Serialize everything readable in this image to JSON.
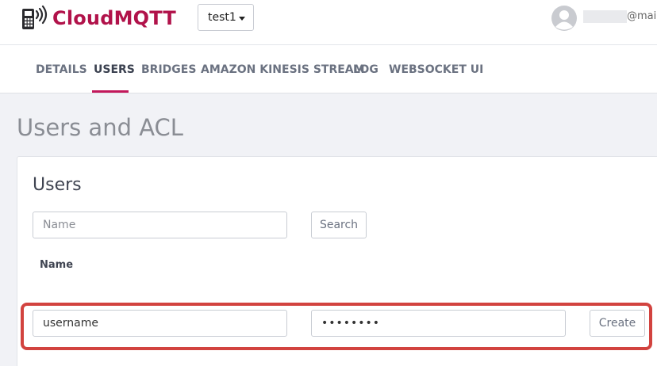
{
  "brand": {
    "name": "CloudMQTT",
    "logo_icon": "mqtt-device-icon",
    "color": "#b1124a"
  },
  "instance_selector": {
    "selected": "test1"
  },
  "user": {
    "email_fragment": "@mai",
    "avatar_icon": "user-avatar-icon"
  },
  "tabs": [
    {
      "label": "DETAILS",
      "active": false
    },
    {
      "label": "USERS",
      "active": true
    },
    {
      "label": "BRIDGES",
      "active": false
    },
    {
      "label": "AMAZON KINESIS STREAM",
      "active": false
    },
    {
      "label": "LOG",
      "active": false
    },
    {
      "label": "WEBSOCKET UI",
      "active": false
    }
  ],
  "page": {
    "title": "Users and ACL"
  },
  "users_card": {
    "title": "Users",
    "search_input": {
      "placeholder": "Name",
      "value": ""
    },
    "search_button": "Search",
    "column_header": "Name",
    "create_form": {
      "username_value": "username",
      "password_value": "••••••••",
      "create_button": "Create"
    }
  },
  "colors": {
    "accent": "#c2185b",
    "highlight_border": "#d2433f",
    "page_background": "#f1f2f6"
  }
}
